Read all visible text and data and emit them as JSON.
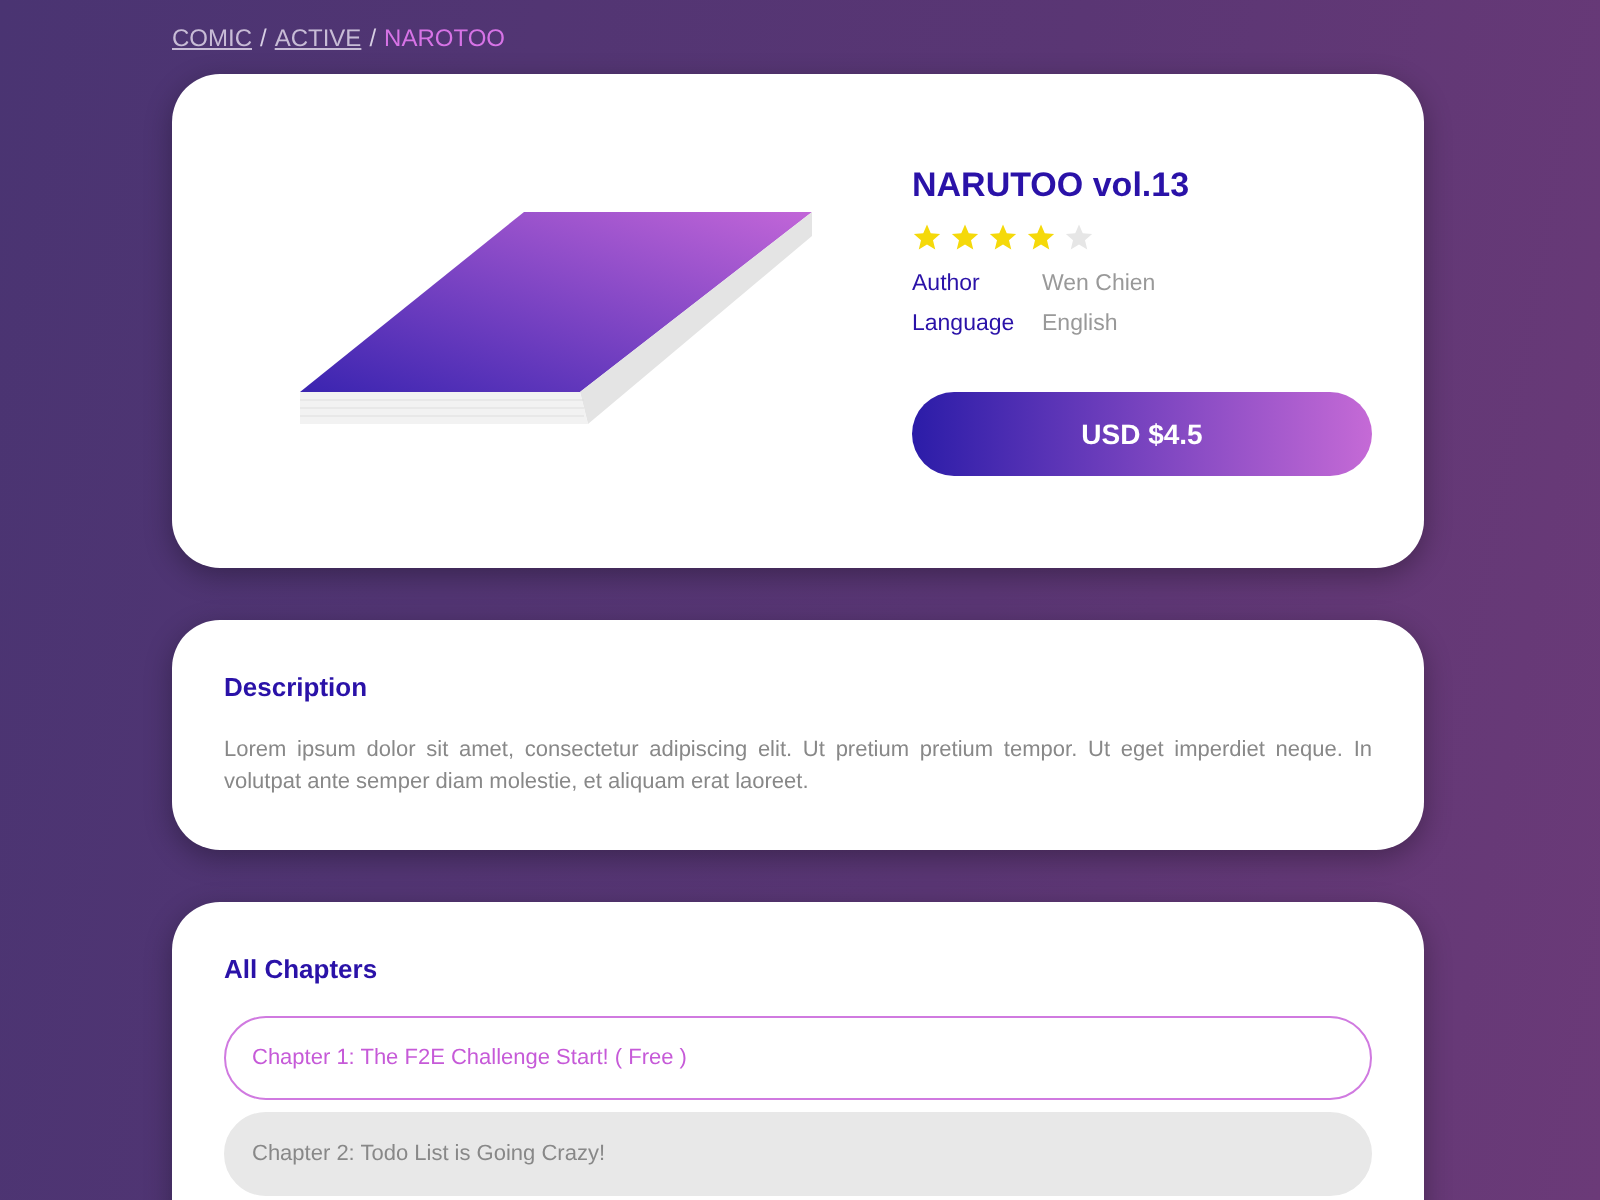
{
  "breadcrumb": [
    {
      "label": "COMIC",
      "selected": false
    },
    {
      "separator": "/",
      "label": "ACTIVE",
      "selected": false
    },
    {
      "separator": "/",
      "label": "NAROTOO",
      "selected": true
    }
  ],
  "product": {
    "title": "NARUTOO vol.13",
    "stars": 4,
    "details": [
      {
        "label": "Author",
        "value": "Wen Chien"
      },
      {
        "label": "Language",
        "value": "English"
      }
    ],
    "price": "USD $4.5"
  },
  "description": {
    "title": "Description",
    "text": "Lorem ipsum dolor sit amet, consectetur adipiscing elit. Ut pretium pretium tempor. Ut eget imperdiet neque. In volutpat ante semper diam molestie, et aliquam erat laoreet."
  },
  "chapters": {
    "title": "All Chapters",
    "items": [
      {
        "label": "Chapter 1: The F2E Challenge Start! ( Free )",
        "selected": true
      },
      {
        "label": "Chapter 2: Todo List is Going Crazy!",
        "selected": false
      }
    ]
  }
}
